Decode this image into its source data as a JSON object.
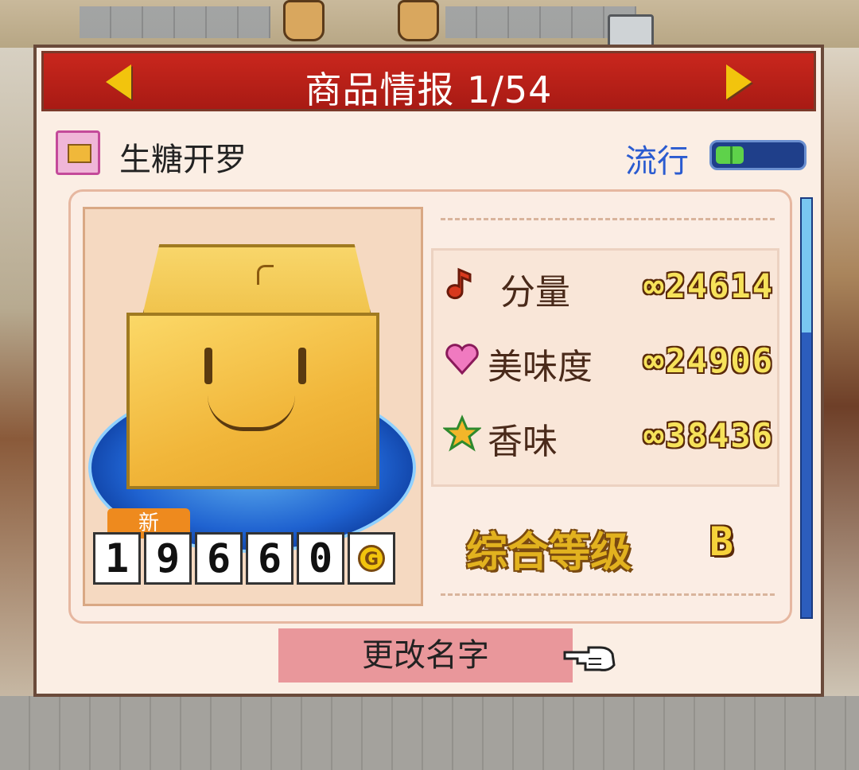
{
  "header": {
    "title": "商品情报 1/54",
    "prev_icon": "arrow-left-icon",
    "next_icon": "arrow-right-icon"
  },
  "product": {
    "name": "生糖开罗",
    "icon": "gift-box-icon",
    "new_badge": "新",
    "price_digits": [
      "1",
      "9",
      "6",
      "6",
      "0"
    ],
    "currency_symbol": "G",
    "currency_icon": "gold-coin-icon"
  },
  "trend": {
    "label": "流行",
    "level_fraction": 0.33,
    "fill_color": "#5ed24a"
  },
  "stats": [
    {
      "label": "分量",
      "value": "∞24614",
      "icon": "music-note-icon",
      "color": "#d8391e"
    },
    {
      "label": "美味度",
      "value": "∞24906",
      "icon": "heart-icon",
      "color": "#f07ac0"
    },
    {
      "label": "香味",
      "value": "∞38436",
      "icon": "star-icon",
      "color": "#f2b62a"
    }
  ],
  "grade": {
    "label": "综合等级",
    "value": "B"
  },
  "actions": {
    "rename_label": "更改名字",
    "pointer_icon": "pointing-hand-icon"
  },
  "scroll": {
    "position_fraction": 0.0
  }
}
